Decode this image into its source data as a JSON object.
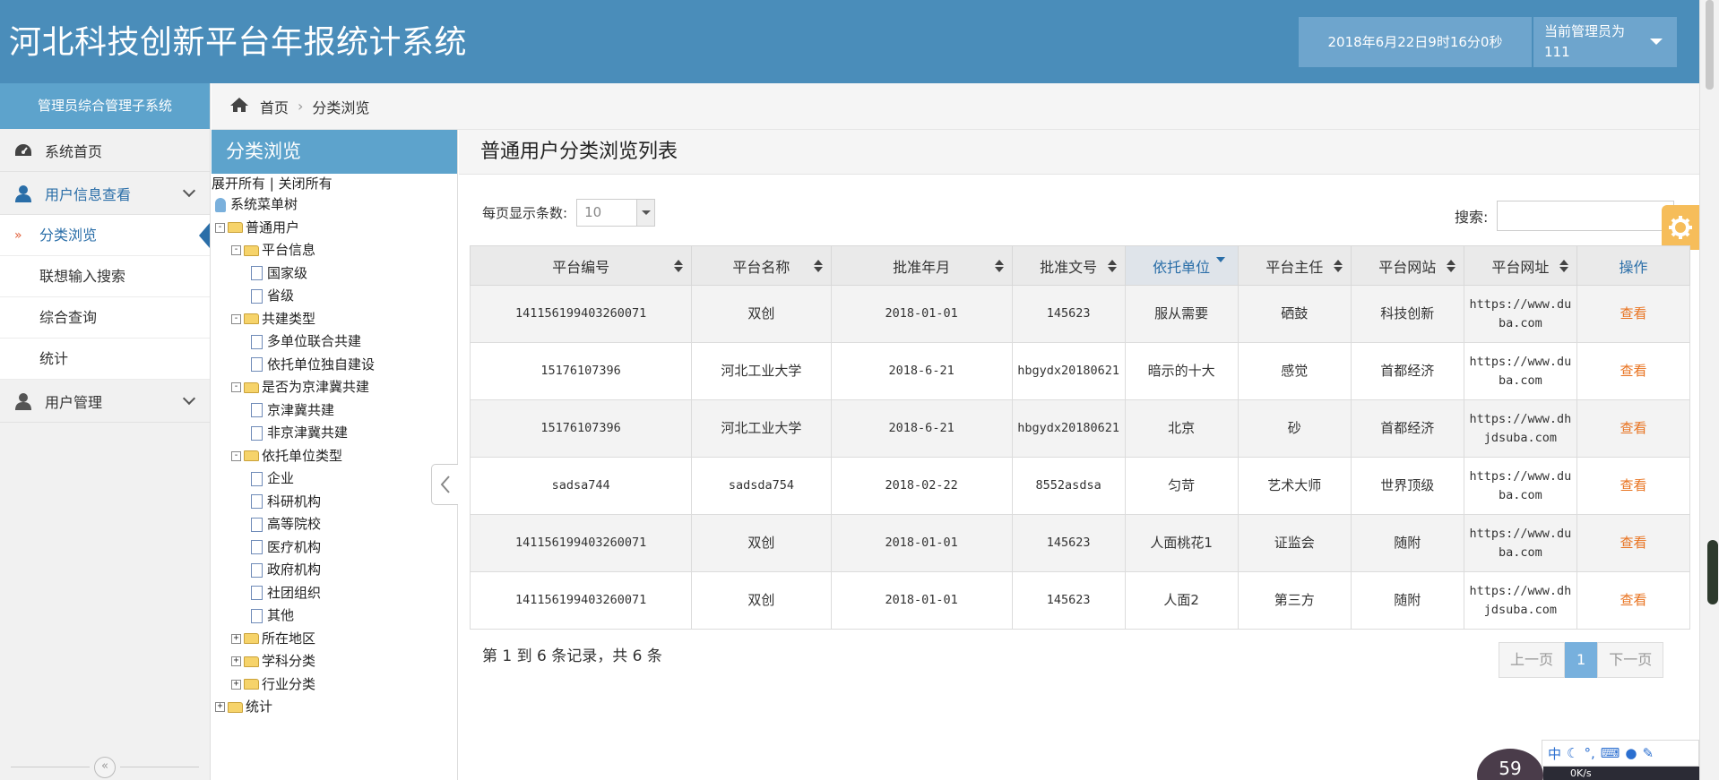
{
  "header": {
    "title": "河北科技创新平台年报统计系统",
    "datetime": "2018年6月22日9时16分0秒",
    "admin_label": "当前管理员为",
    "admin_name": "111"
  },
  "sidebar": {
    "subsystem": "管理员综合管理子系统",
    "items": [
      {
        "label": "系统首页",
        "icon": "dashboard-icon"
      },
      {
        "label": "用户信息查看",
        "icon": "user-icon"
      },
      {
        "label": "用户管理",
        "icon": "user-icon"
      }
    ],
    "sub_items": [
      {
        "label": "分类浏览",
        "mark": "»"
      },
      {
        "label": "联想输入搜索"
      },
      {
        "label": "综合查询"
      },
      {
        "label": "统计"
      }
    ],
    "collapse_glyph": "«"
  },
  "breadcrumb": {
    "home": "首页",
    "separator": "›",
    "current": "分类浏览"
  },
  "tree": {
    "title": "分类浏览",
    "expand_all": "展开所有",
    "toolbar_sep": " | ",
    "collapse_all": "关闭所有",
    "nodes": [
      {
        "label": "系统菜单树",
        "type": "root"
      },
      {
        "label": "普通用户",
        "type": "folder",
        "exp": "-"
      },
      {
        "label": "平台信息",
        "type": "folder",
        "exp": "-"
      },
      {
        "label": "国家级",
        "type": "doc"
      },
      {
        "label": "省级",
        "type": "doc"
      },
      {
        "label": "共建类型",
        "type": "folder",
        "exp": "-"
      },
      {
        "label": "多单位联合共建",
        "type": "doc"
      },
      {
        "label": "依托单位独自建设",
        "type": "doc"
      },
      {
        "label": "是否为京津冀共建",
        "type": "folder",
        "exp": "-"
      },
      {
        "label": "京津冀共建",
        "type": "doc"
      },
      {
        "label": "非京津冀共建",
        "type": "doc"
      },
      {
        "label": "依托单位类型",
        "type": "folder",
        "exp": "-"
      },
      {
        "label": "企业",
        "type": "doc"
      },
      {
        "label": "科研机构",
        "type": "doc"
      },
      {
        "label": "高等院校",
        "type": "doc"
      },
      {
        "label": "医疗机构",
        "type": "doc"
      },
      {
        "label": "政府机构",
        "type": "doc"
      },
      {
        "label": "社团组织",
        "type": "doc"
      },
      {
        "label": "其他",
        "type": "doc"
      },
      {
        "label": "所在地区",
        "type": "folder",
        "exp": "+"
      },
      {
        "label": "学科分类",
        "type": "folder",
        "exp": "+"
      },
      {
        "label": "行业分类",
        "type": "folder",
        "exp": "+"
      },
      {
        "label": "统计",
        "type": "folder",
        "exp": "+"
      }
    ]
  },
  "main": {
    "title": "普通用户分类浏览列表",
    "page_size_label": "每页显示条数:",
    "page_size_value": "10",
    "search_label": "搜索:",
    "columns": [
      "平台编号",
      "平台名称",
      "批准年月",
      "批准文号",
      "依托单位",
      "平台主任",
      "平台网站",
      "平台网址",
      "操作"
    ],
    "rows": [
      [
        "141156199403260071",
        "双创",
        "2018-01-01",
        "145623",
        "服从需要",
        "硒鼓",
        "科技创新",
        "https://www.duba.com",
        "查看"
      ],
      [
        "15176107396",
        "河北工业大学",
        "2018-6-21",
        "hbgydx20180621",
        "暗示的十大",
        "感觉",
        "首都经济",
        "https://www.duba.com",
        "查看"
      ],
      [
        "15176107396",
        "河北工业大学",
        "2018-6-21",
        "hbgydx20180621",
        "北京",
        "砂",
        "首都经济",
        "https://www.dhjdsuba.com",
        "查看"
      ],
      [
        "sadsa744",
        "sadsda754",
        "2018-02-22",
        "8552asdsa",
        "匀苛",
        "艺术大师",
        "世界顶级",
        "https://www.duba.com",
        "查看"
      ],
      [
        "141156199403260071",
        "双创",
        "2018-01-01",
        "145623",
        "人面桃花1",
        "证监会",
        "随附",
        "https://www.duba.com",
        "查看"
      ],
      [
        "141156199403260071",
        "双创",
        "2018-01-01",
        "145623",
        "人面2",
        "第三方",
        "随附",
        "https://www.dhjdsuba.com",
        "查看"
      ]
    ],
    "records_text": "第 1 到 6 条记录，共 6 条",
    "pager": {
      "prev": "上一页",
      "current": "1",
      "next": "下一页"
    }
  },
  "overlay": {
    "widget_value": "59",
    "speed": "0K/s",
    "toolbar_glyph": "中"
  }
}
